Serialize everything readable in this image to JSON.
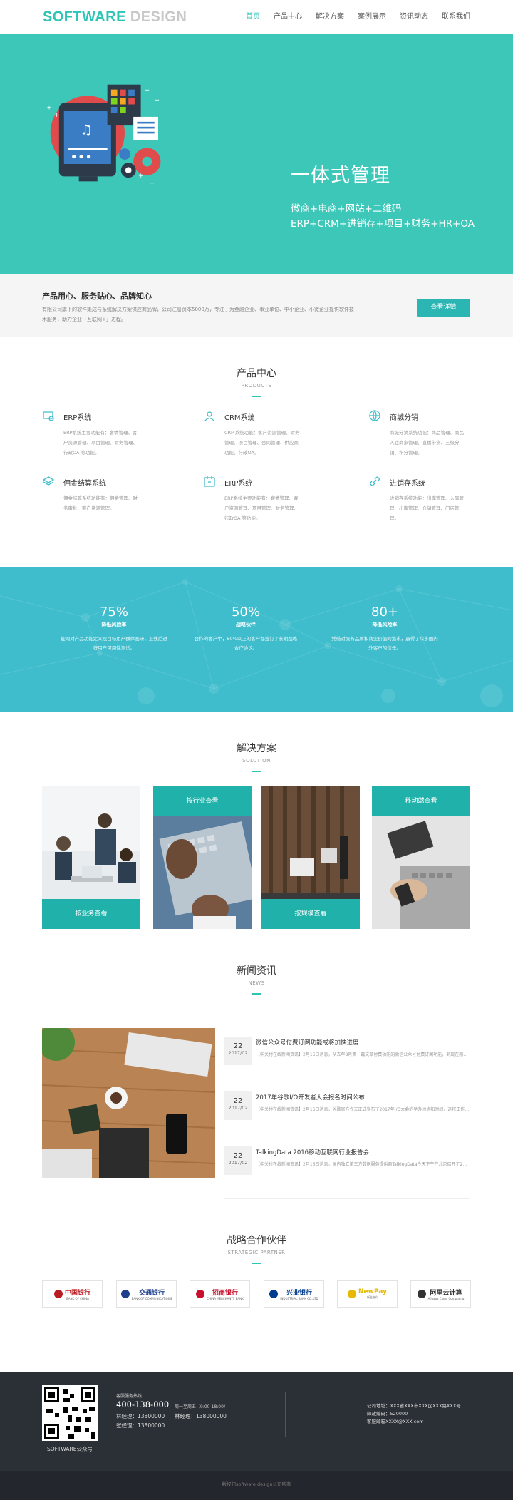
{
  "header": {
    "logo_part1": "SOFTWARE",
    "logo_part2": "DESIGN",
    "nav": [
      "首页",
      "产品中心",
      "解决方案",
      "案例展示",
      "资讯动态",
      "联系我们"
    ]
  },
  "banner": {
    "title": "一体式管理",
    "line1": "微商+电商+网站+二维码",
    "line2": "ERP+CRM+进销存+项目+财务+HR+OA",
    "slide_active": 1,
    "slide_count": 2
  },
  "intro": {
    "title": "产品用心、服务贴心、品牌知心",
    "desc": "有限公司旗下的软件集成与系统解决方案供应商品牌，公司注册资本5000万，专注于为金融企业、事业单位、中小企业、小微企业提供软件技术服务，助力企业「互联网+」进程。",
    "button": "查看详情"
  },
  "products": {
    "title": "产品中心",
    "subtitle": "PRODUCTS",
    "items": [
      {
        "icon": "erp-icon",
        "name": "ERP系统",
        "desc": "ERP系统主要功能有：客情管理、客户资源管理、项目管理、财务管理、行政OA 等功能。"
      },
      {
        "icon": "crm-icon",
        "name": "CRM系统",
        "desc": "CRM系统功能：客户资源管理、财务管理、项目管理、合同管理、供应商功能、行政OA。"
      },
      {
        "icon": "globe-icon",
        "name": "商城分销",
        "desc": "商城分销系统功能：商品管理、商品入驻商家管理、直播带货、三级分销、积分管理。"
      },
      {
        "icon": "layers-icon",
        "name": "佣金结算系统",
        "desc": "佣金结算系统功能有：佣金管理、财务审批、客户资源管理。"
      },
      {
        "icon": "calendar-icon",
        "name": "ERP系统",
        "desc": "ERP系统主要功能有：客情管理、客户资源管理、项目管理、财务管理、行政OA 等功能。"
      },
      {
        "icon": "link-icon",
        "name": "进销存系统",
        "desc": "进销存系统功能：出库管理、入库管理、出库管理、仓储管理、门店管理。"
      }
    ]
  },
  "stats": [
    {
      "num": "75%",
      "label": "降低风险率",
      "desc": "能闻对产品功能定义及目标用户群体画研，上线后进行用户可用性测试。"
    },
    {
      "num": "50%",
      "label": "战略伙伴",
      "desc": "合作的客户中，50%以上的客户都签订了长期战略合作协议。"
    },
    {
      "num": "80+",
      "label": "降低风险率",
      "desc": "凭借对服务品质和商业价值的追求，赢得了众多国内外客户的信任。"
    }
  ],
  "solutions": {
    "title": "解决方案",
    "subtitle": "SOLUTION",
    "items": [
      "按业务查看",
      "按行业查看",
      "按规模查看",
      "移动端查看"
    ]
  },
  "news": {
    "title": "新闻资讯",
    "subtitle": "NEWS",
    "items": [
      {
        "day": "22",
        "ym": "2017/02",
        "title": "微信公众号付费订阅功能或将加快进度",
        "summary": "【中关村在线新闻资讯】2月15日消息，从去年8月第一篇文章付费功能的微信公众号付费订阅功能，到现在刚了无止..."
      },
      {
        "day": "22",
        "ym": "2017/02",
        "title": "2017年谷歌I/O开发者大会报名时间公布",
        "summary": "【中关村在线新闻资讯】2月16日消息，谷歌官方今天正式宣布了2017年I/O大会的举办地点和时间，这将工作将..."
      },
      {
        "day": "22",
        "ym": "2017/02",
        "title": "TalkingData 2016移动互联网行业报告会",
        "summary": "【中关村在线新闻资讯】2月16日消息，国内独立第三方数据服务提供商TalkingData今天下午在北京召开了2016..."
      }
    ]
  },
  "partners": {
    "title": "战略合作伙伴",
    "subtitle": "STRATEGIC PARTNER",
    "items": [
      {
        "name": "中国银行",
        "sub": "BANK OF CHINA",
        "color": "#b81c22"
      },
      {
        "name": "交通银行",
        "sub": "BANK OF COMMUNICATIONS",
        "color": "#1d3f8c"
      },
      {
        "name": "招商银行",
        "sub": "CHINA MERCHANTS BANK",
        "color": "#c8102e"
      },
      {
        "name": "兴业银行",
        "sub": "INDUSTRIAL BANK CO.,LTD",
        "color": "#003c8f"
      },
      {
        "name": "NewPay",
        "sub": "新生支付",
        "color": "#e6b800"
      },
      {
        "name": "阿里云计算",
        "sub": "Alibaba Cloud Computing",
        "color": "#333333"
      }
    ]
  },
  "footer": {
    "qr_label": "SOFTWARE公众号",
    "hotline_label": "客服服务热线",
    "hotline": "400-138-000",
    "hours": "周一至周五（9:00-18:00）",
    "managers": [
      "林经理：13800000",
      "张经理：13800000",
      "林经理：138000000"
    ],
    "address": "公司地址：XXX省XXX市XXX区XXX路XXX号",
    "postcode": "邮政编码：520000",
    "email": "客服邮箱XXXX@XXX.com",
    "copyright": "版权归software design公司所有"
  },
  "colors": {
    "accent": "#2ec4b6",
    "banner": "#3cc7b8",
    "stats": "#3fbdcc",
    "footer": "#2b3036"
  }
}
